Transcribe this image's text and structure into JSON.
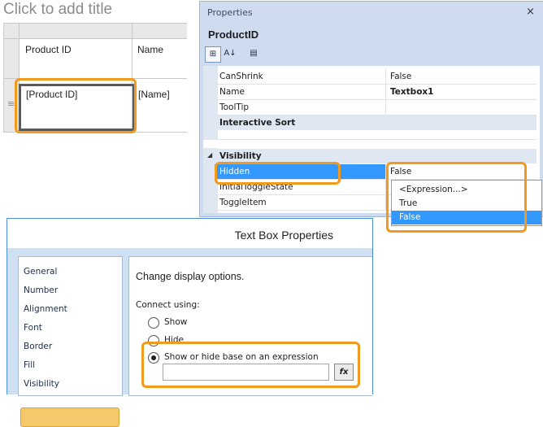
{
  "report": {
    "title_placeholder": "Click to add title",
    "header_cells": [
      "Product ID",
      "Name"
    ],
    "detail_cells": [
      "[Product ID]",
      "[Name]"
    ]
  },
  "properties_panel": {
    "title": "Properties",
    "close_glyph": "×",
    "object_name": "ProductID",
    "toolbar": {
      "categorized_glyph": "⊞",
      "alphabetical_glyph": "A↓",
      "pages_glyph": "▤"
    },
    "rows_top": [
      {
        "name": "CanShrink",
        "value": "False",
        "bold_value": false
      },
      {
        "name": "Name",
        "value": "Textbox1",
        "bold_value": true
      },
      {
        "name": "ToolTip",
        "value": "",
        "bold_value": false
      }
    ],
    "category_interactive": "Interactive Sort",
    "category_visibility": "Visibility",
    "collapse_glyph": "◢",
    "rows_visibility": [
      {
        "name": "Hidden",
        "value": "False",
        "selected": true
      },
      {
        "name": "InitialToggleState",
        "value": ""
      },
      {
        "name": "ToggleItem",
        "value": ""
      }
    ],
    "dropdown_options": [
      "<Expression...>",
      "True",
      "False"
    ],
    "dropdown_selected": "False"
  },
  "dialog": {
    "title": "Text Box Properties",
    "nav_items": [
      "General",
      "Number",
      "Alignment",
      "Font",
      "Border",
      "Fill",
      "Visibility"
    ],
    "nav_selected": "Visibility",
    "heading": "Change display options.",
    "connect_label": "Connect using:",
    "radio_show": "Show",
    "radio_hide": "Hide",
    "radio_expression": "Show or hide base on an expression",
    "fx_label": "fx",
    "expression_value": ""
  },
  "colors": {
    "highlight_orange": "#f19a1e",
    "selection_blue": "#3399ff",
    "panel_blue": "#cfdcf0",
    "nav_selected": "#f5c96a"
  }
}
